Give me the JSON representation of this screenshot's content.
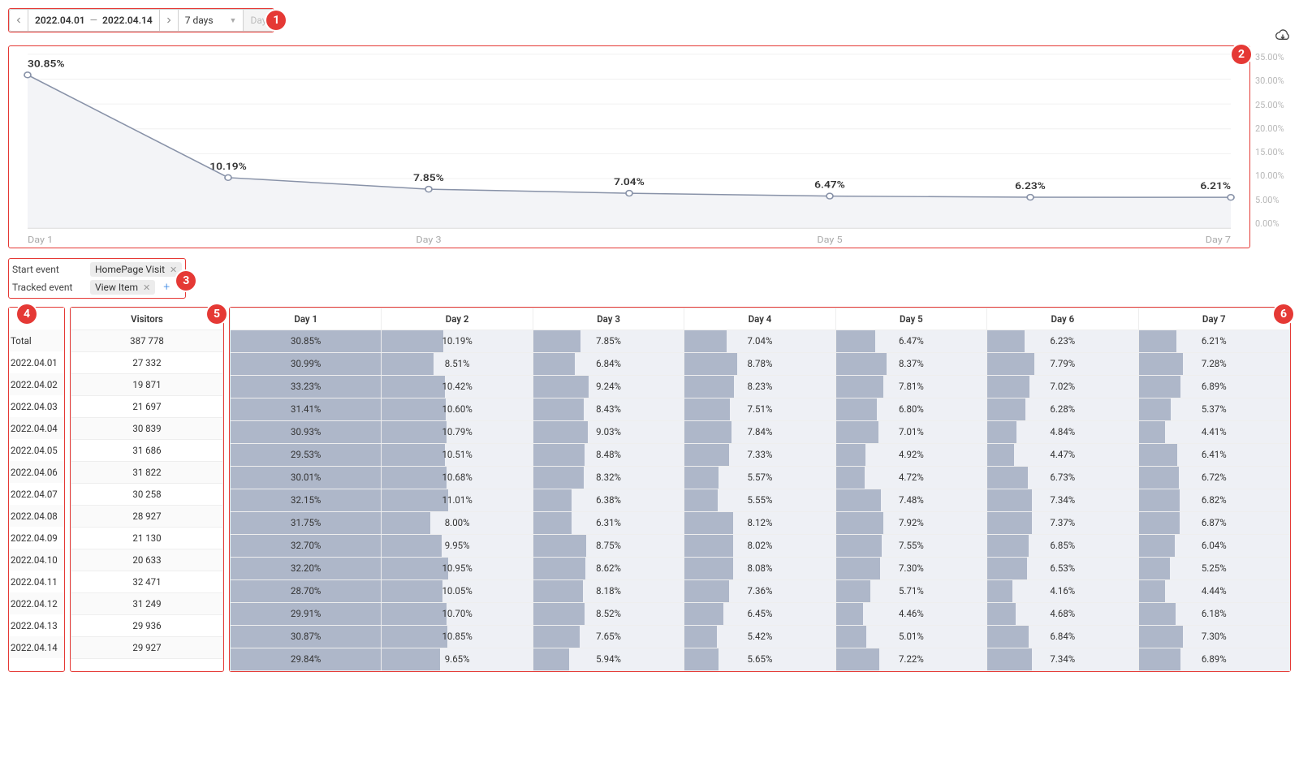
{
  "controls": {
    "date_from": "2022.04.01",
    "date_to": "2022.04.14",
    "range_dropdown": "7 days",
    "granularity_disabled": "Day"
  },
  "annotations": {
    "b1": "1",
    "b2": "2",
    "b3": "3",
    "b4": "4",
    "b5": "5",
    "b6": "6"
  },
  "chart_data": {
    "type": "line",
    "title": "",
    "xlabel": "",
    "ylabel": "",
    "ylim": [
      0,
      35
    ],
    "y_ticks": [
      "35.00%",
      "30.00%",
      "25.00%",
      "20.00%",
      "15.00%",
      "10.00%",
      "5.00%",
      "0.00%"
    ],
    "x_ticks": [
      "Day 1",
      "Day 3",
      "Day 5",
      "Day 7"
    ],
    "categories": [
      "Day 1",
      "Day 2",
      "Day 3",
      "Day 4",
      "Day 5",
      "Day 6",
      "Day 7"
    ],
    "values": [
      30.85,
      10.19,
      7.85,
      7.04,
      6.47,
      6.23,
      6.21
    ],
    "point_labels": [
      "30.85%",
      "10.19%",
      "7.85%",
      "7.04%",
      "6.47%",
      "6.23%",
      "6.21%"
    ]
  },
  "events": {
    "start_label": "Start event",
    "start_chip": "HomePage Visit",
    "tracked_label": "Tracked event",
    "tracked_chip": "View Item"
  },
  "table": {
    "visitors_header": "Visitors",
    "day_headers": [
      "Day 1",
      "Day 2",
      "Day 3",
      "Day 4",
      "Day 5",
      "Day 6",
      "Day 7"
    ],
    "rows": [
      {
        "date": "Total",
        "visitors": "387 778",
        "pct": [
          30.85,
          10.19,
          7.85,
          7.04,
          6.47,
          6.23,
          6.21
        ]
      },
      {
        "date": "2022.04.01",
        "visitors": "27 332",
        "pct": [
          30.99,
          8.51,
          6.84,
          8.78,
          8.37,
          7.79,
          7.28
        ]
      },
      {
        "date": "2022.04.02",
        "visitors": "19 871",
        "pct": [
          33.23,
          10.42,
          9.24,
          8.23,
          7.81,
          7.02,
          6.89
        ]
      },
      {
        "date": "2022.04.03",
        "visitors": "21 697",
        "pct": [
          31.41,
          10.6,
          8.43,
          7.51,
          6.8,
          6.28,
          5.37
        ]
      },
      {
        "date": "2022.04.04",
        "visitors": "30 839",
        "pct": [
          30.93,
          10.79,
          9.03,
          7.84,
          7.01,
          4.84,
          4.41
        ]
      },
      {
        "date": "2022.04.05",
        "visitors": "31 686",
        "pct": [
          29.53,
          10.51,
          8.48,
          7.33,
          4.92,
          4.47,
          6.41
        ]
      },
      {
        "date": "2022.04.06",
        "visitors": "31 822",
        "pct": [
          30.01,
          10.68,
          8.32,
          5.57,
          4.72,
          6.73,
          6.72
        ]
      },
      {
        "date": "2022.04.07",
        "visitors": "30 258",
        "pct": [
          32.15,
          11.01,
          6.38,
          5.55,
          7.48,
          7.34,
          6.82
        ]
      },
      {
        "date": "2022.04.08",
        "visitors": "28 927",
        "pct": [
          31.75,
          8.0,
          6.31,
          8.12,
          7.92,
          7.37,
          6.87
        ]
      },
      {
        "date": "2022.04.09",
        "visitors": "21 130",
        "pct": [
          32.7,
          9.95,
          8.75,
          8.02,
          7.55,
          6.85,
          6.04
        ]
      },
      {
        "date": "2022.04.10",
        "visitors": "20 633",
        "pct": [
          32.2,
          10.95,
          8.62,
          8.08,
          7.3,
          6.53,
          5.25
        ]
      },
      {
        "date": "2022.04.11",
        "visitors": "32 471",
        "pct": [
          28.7,
          10.05,
          8.18,
          7.36,
          5.71,
          4.16,
          4.44
        ]
      },
      {
        "date": "2022.04.12",
        "visitors": "31 249",
        "pct": [
          29.91,
          10.7,
          8.52,
          6.45,
          4.46,
          4.68,
          6.18
        ]
      },
      {
        "date": "2022.04.13",
        "visitors": "29 936",
        "pct": [
          30.87,
          10.85,
          7.65,
          5.42,
          5.01,
          6.84,
          7.3
        ]
      },
      {
        "date": "2022.04.14",
        "visitors": "29 927",
        "pct": [
          29.84,
          9.65,
          5.94,
          5.65,
          7.22,
          7.34,
          6.89
        ]
      }
    ]
  }
}
